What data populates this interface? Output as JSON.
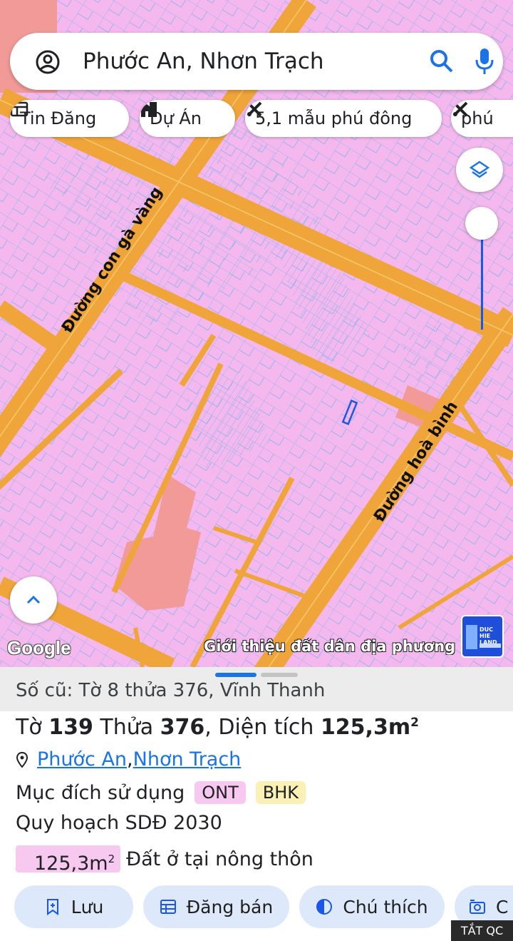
{
  "search": {
    "query": "Phước An, Nhơn Trạch"
  },
  "chips": [
    {
      "label": "Tin Đăng",
      "icon": "listing-icon"
    },
    {
      "label": "Dự Án",
      "icon": "project-house-icon"
    },
    {
      "label": "5,1 mẫu phú đông",
      "icon": "tools-icon"
    },
    {
      "label": "phú",
      "icon": "tools-icon"
    }
  ],
  "map": {
    "road_labels": [
      "Đường con gà vàng",
      "Đường hoà bình"
    ],
    "attribution": "Google",
    "overlay_caption": "Giới thiệu đất dân địa phương giá",
    "brand_badge": "DUC HIE LAND",
    "layer_opacity": 0.25
  },
  "details": {
    "old_ref": "Số cũ: Tờ 8 thửa 376, Vĩnh Thanh",
    "title_sheet_prefix": "Tờ ",
    "sheet_no": "139",
    "title_parcel_prefix": " Thửa ",
    "parcel_no": "376",
    "title_area_prefix": ", Diện tích ",
    "area_value": "125,3m",
    "area_sup": "2",
    "ward": "Phước An",
    "district": "Nhơn Trạch",
    "separator": ", ",
    "usage_label": "Mục đích sử dụng",
    "usage_tags": [
      "ONT",
      "BHK"
    ],
    "plan_label": "Quy hoạch SDĐ 2030",
    "plan_area": "125,3m",
    "plan_area_sup": "2",
    "plan_desc": "Đất ở tại nông thôn"
  },
  "actions": [
    {
      "label": "Lưu",
      "icon": "bookmark-add-icon"
    },
    {
      "label": "Đăng bán",
      "icon": "listing-icon"
    },
    {
      "label": "Chú thích",
      "icon": "legend-contrast-icon"
    },
    {
      "label": "C",
      "icon": "camera-icon"
    }
  ],
  "ad_label": "TẮT QC",
  "colors": {
    "land_residential": "#f5b8ee",
    "parcel_line": "#7fb0e8",
    "road": "#f0a53a",
    "public_land": "#f29a98",
    "accent": "#1a73e8",
    "tag_ont": "#f7c9f0",
    "tag_bhk": "#fbf0b6",
    "action_bg": "#dde9fb"
  }
}
